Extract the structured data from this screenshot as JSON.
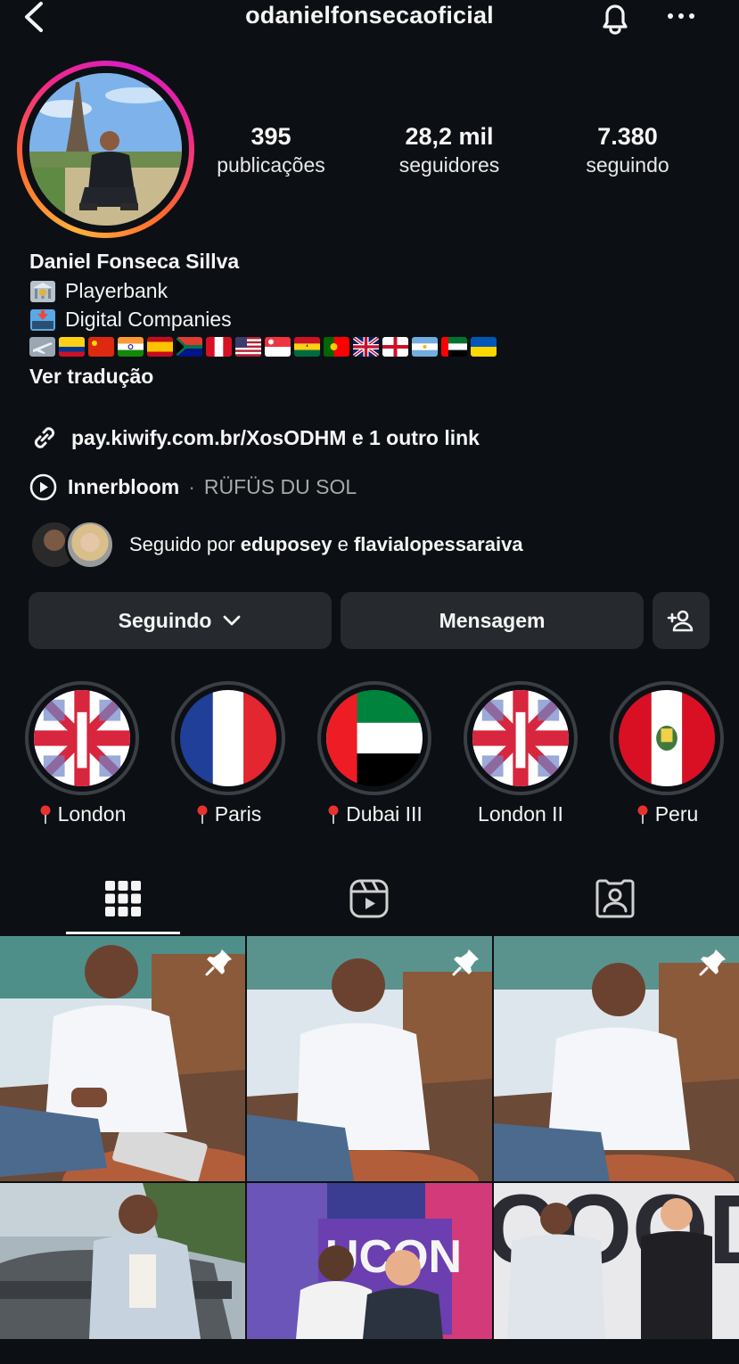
{
  "header": {
    "username": "odanielfonsecaoficial",
    "back_icon": "chevron-left-icon",
    "bell_icon": "bell-icon",
    "more_icon": "more-horizontal-icon"
  },
  "stats": [
    {
      "value": "395",
      "label": "publicações"
    },
    {
      "value": "28,2 mil",
      "label": "seguidores"
    },
    {
      "value": "7.380",
      "label": "seguindo"
    }
  ],
  "bio": {
    "name": "Daniel Fonseca Sillva",
    "line1": "Playerbank",
    "line2": "Digital Companies",
    "translate": "Ver tradução"
  },
  "link": {
    "text": "pay.kiwify.com.br/XosODHM e 1 outro link"
  },
  "music": {
    "song": "Innerbloom",
    "separator": "·",
    "artist": "RÜFÜS DU SOL"
  },
  "followed_by": {
    "prefix": "Seguido por",
    "user1": "eduposey",
    "conj": "e",
    "user2": "flavialopessaraiva"
  },
  "actions": {
    "following": "Seguindo",
    "message": "Mensagem"
  },
  "highlights": [
    {
      "label": "London",
      "pin": true
    },
    {
      "label": "Paris",
      "pin": true
    },
    {
      "label": "Dubai III",
      "pin": true
    },
    {
      "label": "London II",
      "pin": false
    },
    {
      "label": "Peru",
      "pin": true
    }
  ],
  "tabs": [
    "grid-icon",
    "reels-icon",
    "tagged-icon"
  ]
}
